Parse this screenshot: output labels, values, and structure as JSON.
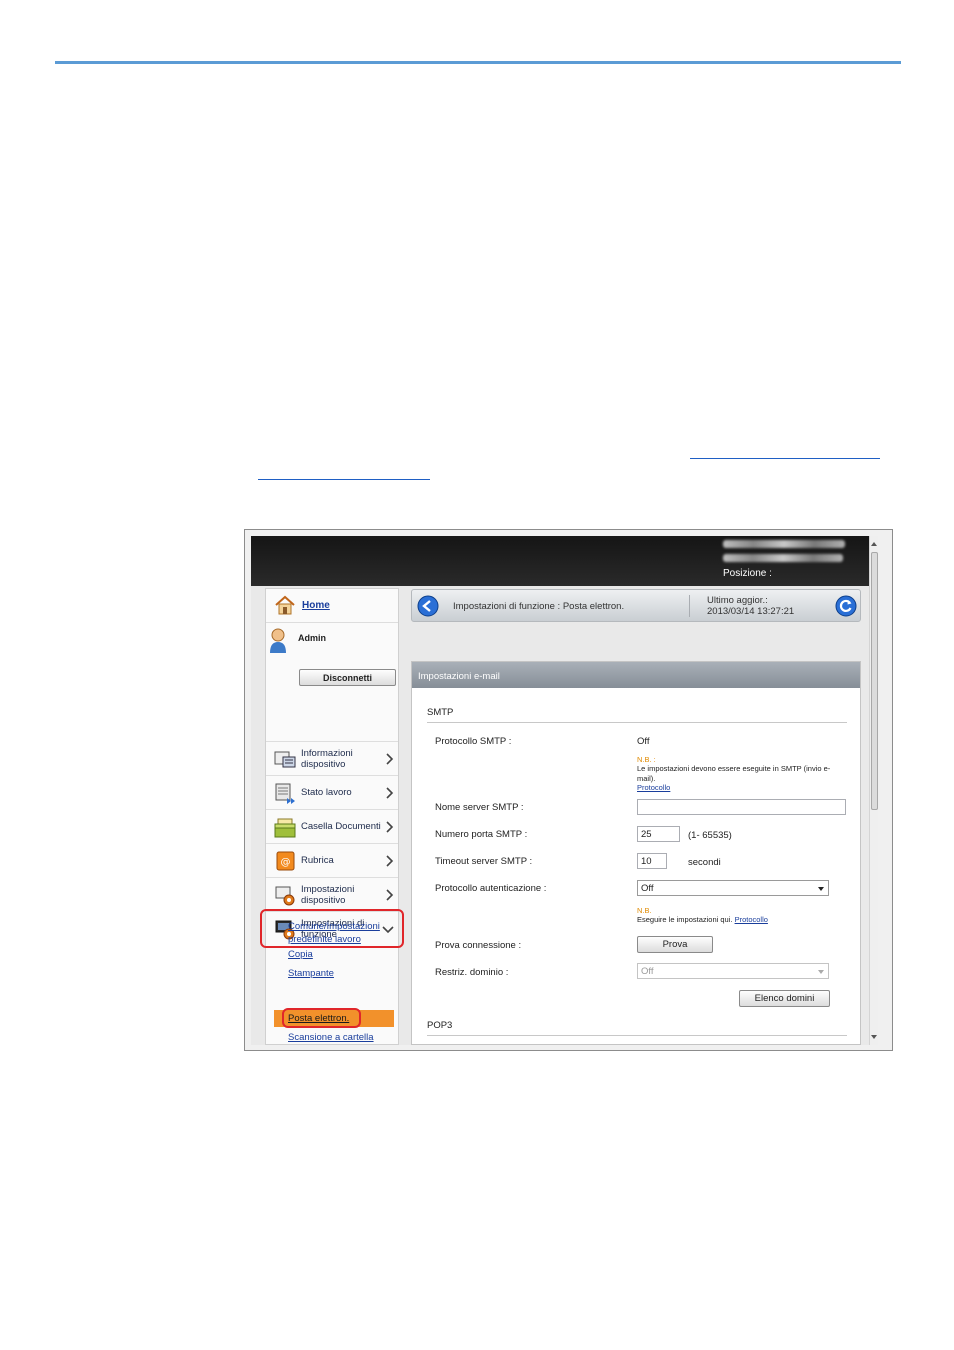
{
  "header": {
    "position_label": "Posizione :"
  },
  "nav": {
    "home": "Home",
    "admin": "Admin",
    "logout": "Disconnetti",
    "items": [
      {
        "label": "Informazioni dispositivo",
        "icon": "device-info-icon"
      },
      {
        "label": "Stato lavoro",
        "icon": "job-status-icon"
      },
      {
        "label": "Casella Documenti",
        "icon": "document-box-icon"
      },
      {
        "label": "Rubrica",
        "icon": "address-book-icon"
      },
      {
        "label": "Impostazioni dispositivo",
        "icon": "device-settings-icon"
      },
      {
        "label": "Impostazioni di funzione",
        "icon": "function-settings-icon"
      }
    ],
    "subitems": [
      "Comune/Impostazioni predefinite lavoro",
      "Copia",
      "Stampante",
      "Posta elettron.",
      "Scansione a cartella"
    ]
  },
  "breadcrumb": {
    "text": "Impostazioni di funzione : Posta elettron.",
    "updated_label": "Ultimo aggior.:",
    "updated_time": "2013/03/14 13:27:21"
  },
  "panel": {
    "title": "Impostazioni e-mail",
    "smtp_section": "SMTP",
    "pop3_section": "POP3",
    "fields": {
      "smtp_protocol_label": "Protocollo SMTP :",
      "smtp_protocol_value": "Off",
      "note1_head": "N.B. :",
      "note1_text": "Le impostazioni devono essere eseguite in SMTP (invio e-mail).",
      "note1_link": "Protocollo",
      "server_name_label": "Nome server SMTP :",
      "server_name_value": "",
      "port_label": "Numero porta SMTP :",
      "port_value": "25",
      "port_range": "(1- 65535)",
      "timeout_label": "Timeout server SMTP :",
      "timeout_value": "10",
      "timeout_unit": "secondi",
      "auth_label": "Protocollo autenticazione :",
      "auth_value": "Off",
      "note2_head": "N.B.",
      "note2_text": "Eseguire le impostazioni qui.",
      "note2_link": "Protocollo",
      "test_label": "Prova connessione :",
      "test_button": "Prova",
      "domain_label": "Restriz. dominio :",
      "domain_value": "Off",
      "domain_list_button": "Elenco domini"
    }
  }
}
